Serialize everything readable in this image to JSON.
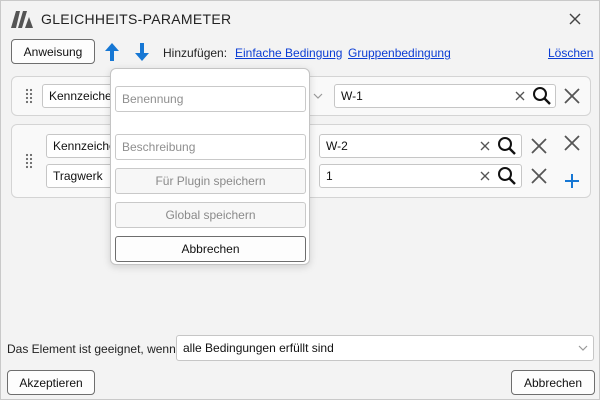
{
  "window": {
    "title": "GLEICHHEITS-PARAMETER",
    "logo_icon": "app-logo",
    "close_icon": "close-icon"
  },
  "toolbar": {
    "instruction_button": "Anweisung",
    "move_up_icon": "arrow-up-icon",
    "move_down_icon": "arrow-down-icon",
    "add_label": "Hinzufügen:",
    "simple_condition_link": "Einfache Bedingung",
    "group_condition_link": "Gruppenbedingung",
    "delete_link": "Löschen",
    "accent_color": "#1677d4"
  },
  "conditions": [
    {
      "parameter": "Kennzeichen",
      "value": "W-1"
    },
    {
      "group": true,
      "rows": [
        {
          "parameter": "Kennzeichen",
          "value": "W-2"
        },
        {
          "parameter": "Tragwerk",
          "value": "1"
        }
      ]
    }
  ],
  "popup": {
    "name_placeholder": "Benennung",
    "description_placeholder": "Beschreibung",
    "save_plugin_button": "Für Plugin speichern",
    "save_global_button": "Global speichern",
    "cancel_button": "Abbrechen"
  },
  "footer": {
    "suitability_label": "Das Element ist geeignet, wenn",
    "mode_select_value": "alle Bedingungen erfüllt sind",
    "accept_button": "Akzeptieren",
    "cancel_button": "Abbrechen"
  }
}
